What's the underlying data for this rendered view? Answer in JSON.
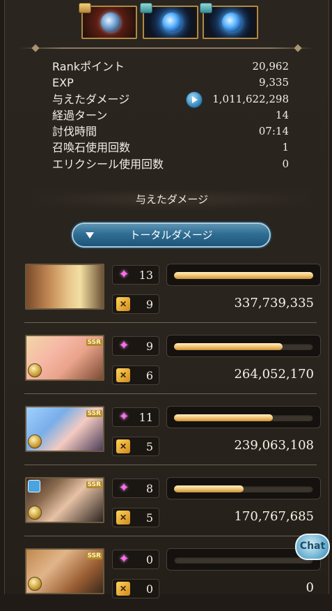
{
  "rewards": [
    {
      "icon": "gold-chest-icon",
      "type": "red"
    },
    {
      "icon": "teal-chest-icon",
      "type": "blue"
    },
    {
      "icon": "teal-chest-icon",
      "type": "blue"
    }
  ],
  "stats": {
    "rank_points": {
      "label": "Rankポイント",
      "value": "20,962"
    },
    "exp": {
      "label": "EXP",
      "value": "9,335"
    },
    "damage": {
      "label": "与えたダメージ",
      "value": "1,011,622,298"
    },
    "turns": {
      "label": "経過ターン",
      "value": "14"
    },
    "time": {
      "label": "討伐時間",
      "value": "07:14"
    },
    "summon_uses": {
      "label": "召喚石使用回数",
      "value": "1"
    },
    "elixir_uses": {
      "label": "エリクシール使用回数",
      "value": "0"
    }
  },
  "section_title": "与えたダメージ",
  "tab_button": "トータルダメージ",
  "members": [
    {
      "skills": "13",
      "ca": "9",
      "damage": "337,739,335",
      "bar_fraction": 1.0,
      "ssr": ""
    },
    {
      "skills": "9",
      "ca": "6",
      "damage": "264,052,170",
      "bar_fraction": 0.78,
      "ssr": "SSR"
    },
    {
      "skills": "11",
      "ca": "5",
      "damage": "239,063,108",
      "bar_fraction": 0.71,
      "ssr": "SSR"
    },
    {
      "skills": "8",
      "ca": "5",
      "damage": "170,767,685",
      "bar_fraction": 0.5,
      "ssr": "SSR"
    },
    {
      "skills": "0",
      "ca": "0",
      "damage": "0",
      "bar_fraction": 0.0,
      "ssr": "SSR"
    }
  ],
  "chat": "Chat",
  "colors": {
    "accent": "#3c8fc2",
    "bar": "#f2c774",
    "skill": "#ff6cf0",
    "ca": "#ffd45a"
  }
}
